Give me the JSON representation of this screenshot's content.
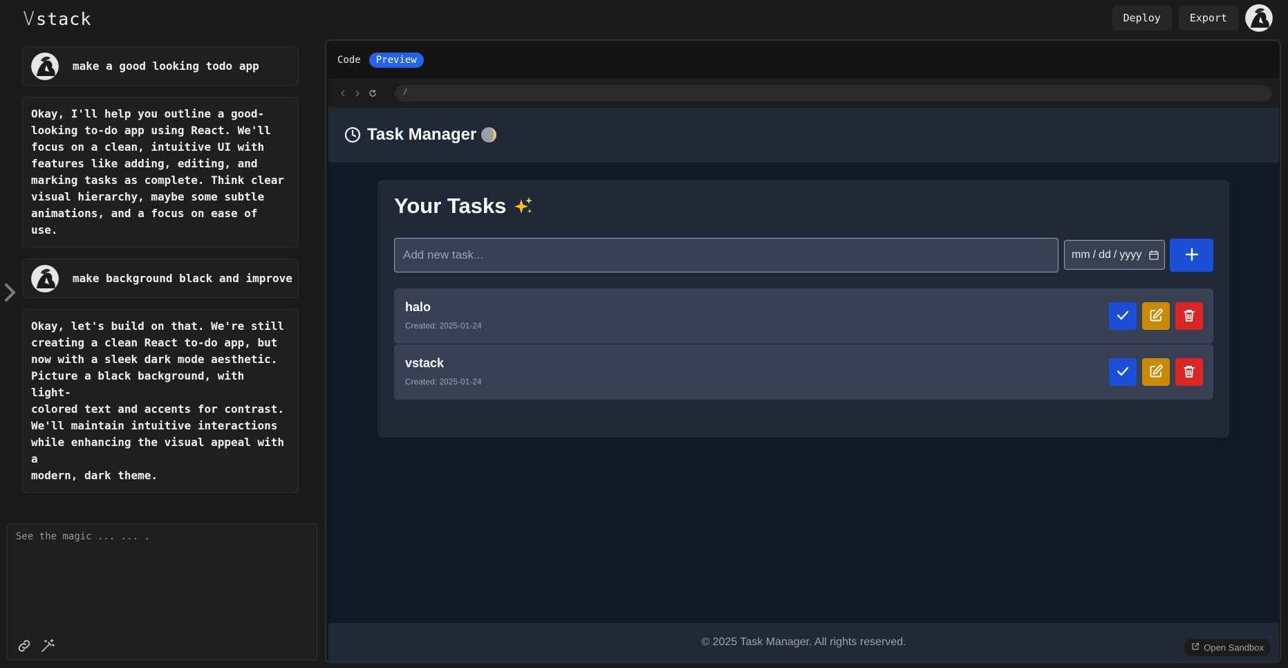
{
  "app": {
    "logo_v": "V",
    "logo_rest": "stack"
  },
  "topbar": {
    "deploy_label": "Deploy",
    "export_label": "Export"
  },
  "chat": {
    "messages": [
      {
        "role": "user",
        "text": "make a good looking todo app"
      },
      {
        "role": "assistant",
        "lines": [
          "Okay, I'll help you outline a good-",
          "looking to-do app using React. We'll",
          "focus on a clean, intuitive UI with",
          "features like adding, editing, and",
          "marking tasks as complete. Think clear",
          "visual hierarchy, maybe some subtle",
          "animations, and a focus on ease of use."
        ]
      },
      {
        "role": "user",
        "text": "make background black and improve"
      },
      {
        "role": "assistant",
        "lines": [
          "Okay, let's build on that. We're still",
          "creating a clean React to-do app, but",
          "now with a sleek dark mode aesthetic.",
          "Picture a black background, with light-",
          "colored text and accents for contrast.",
          "We'll maintain intuitive interactions",
          "while enhancing the visual appeal with a",
          "modern, dark theme."
        ]
      }
    ],
    "prompt_placeholder": "See the magic ... ... ."
  },
  "preview": {
    "tabs": [
      {
        "label": "Code",
        "active": false
      },
      {
        "label": "Preview",
        "active": true
      }
    ],
    "url": "/",
    "header_title": "Task Manager",
    "card_title": "Your Tasks",
    "task_input_placeholder": "Add new task...",
    "date": {
      "mm": "mm",
      "dd": "dd",
      "yyyy": "yyyy",
      "sep": "/"
    },
    "tasks": [
      {
        "name": "halo",
        "created": "Created: 2025-01-24"
      },
      {
        "name": "vstack",
        "created": "Created: 2025-01-24"
      }
    ],
    "footer": "© 2025 Task Manager. All rights reserved.",
    "open_sandbox": "Open Sandbox"
  },
  "colors": {
    "accent_blue": "#2563eb",
    "edit_yellow": "#ca8a04",
    "delete_red": "#dc2626",
    "app_bg": "#111827",
    "card_bg": "#1f2937"
  }
}
